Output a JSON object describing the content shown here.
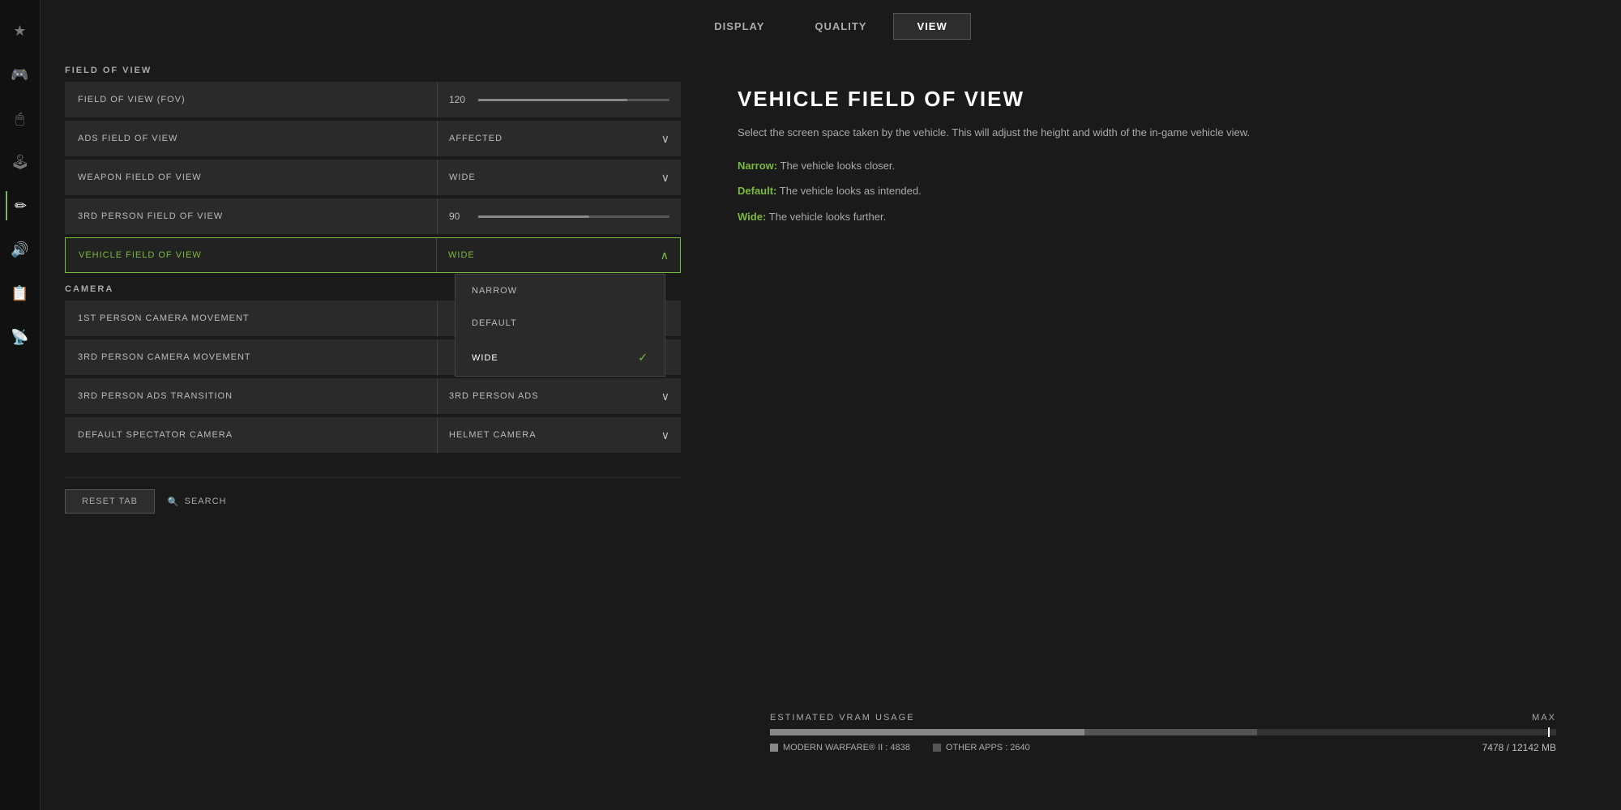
{
  "tabs": [
    {
      "label": "DISPLAY",
      "active": false
    },
    {
      "label": "QUALITY",
      "active": false
    },
    {
      "label": "VIEW",
      "active": true
    }
  ],
  "sidebar": {
    "icons": [
      "★",
      "🎮",
      "🖱",
      "🎮",
      "✏",
      "🔊",
      "📋",
      "📡"
    ]
  },
  "sections": {
    "field_of_view": {
      "label": "FIELD OF VIEW",
      "settings": [
        {
          "name": "FIELD OF VIEW (FOV)",
          "type": "slider",
          "value": "120",
          "fill_percent": 78
        },
        {
          "name": "ADS FIELD OF VIEW",
          "type": "dropdown",
          "value": "AFFECTED"
        },
        {
          "name": "WEAPON FIELD OF VIEW",
          "type": "dropdown",
          "value": "WIDE"
        },
        {
          "name": "3RD PERSON FIELD OF VIEW",
          "type": "slider",
          "value": "90",
          "fill_percent": 58
        },
        {
          "name": "VEHICLE FIELD OF VIEW",
          "type": "dropdown",
          "value": "WIDE",
          "active": true,
          "open": true
        }
      ]
    },
    "camera": {
      "label": "CAMERA",
      "settings": [
        {
          "name": "1ST PERSON CAMERA MOVEMENT",
          "type": "text",
          "value": ""
        },
        {
          "name": "3RD PERSON CAMERA MOVEMENT",
          "type": "text",
          "value": ""
        },
        {
          "name": "3RD PERSON ADS TRANSITION",
          "type": "dropdown",
          "value": "3RD PERSON ADS"
        },
        {
          "name": "DEFAULT SPECTATOR CAMERA",
          "type": "dropdown",
          "value": "HELMET CAMERA"
        }
      ]
    }
  },
  "dropdown_options": [
    {
      "label": "NARROW",
      "selected": false
    },
    {
      "label": "DEFAULT",
      "selected": false
    },
    {
      "label": "WIDE",
      "selected": true
    }
  ],
  "info_panel": {
    "title": "VEHICLE FIELD OF VIEW",
    "description": "Select the screen space taken by the vehicle. This will adjust the height and width of the in-game vehicle view.",
    "items": [
      {
        "label": "Narrow:",
        "text": " The vehicle looks closer."
      },
      {
        "label": "Default:",
        "text": " The vehicle looks as intended."
      },
      {
        "label": "Wide:",
        "text": " The vehicle looks further."
      }
    ]
  },
  "vram": {
    "title": "ESTIMATED VRAM USAGE",
    "max_label": "MAX",
    "mw_label": "MODERN WARFARE® II : 4838",
    "other_label": "OTHER APPS : 2640",
    "value": "7478 / 12142 MB",
    "mw_percent": 40,
    "other_percent": 22,
    "marker_percent": 99
  },
  "bottom": {
    "reset_label": "RESET TAB",
    "search_label": "SEARCH"
  }
}
